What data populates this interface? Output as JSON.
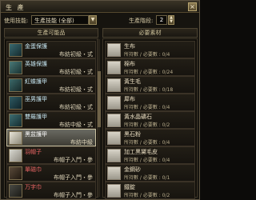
{
  "window": {
    "title": "生 產"
  },
  "filter": {
    "category_label": "使用技能:",
    "category_value": "生產技能 (全部)",
    "grade_label": "生產階段:",
    "grade_value": "2"
  },
  "left_panel": {
    "header": "生產可能品",
    "items": [
      {
        "name": "金蛋保護",
        "sub": "布紡初級・式",
        "color": "#c8e8f4"
      },
      {
        "name": "英雄保護",
        "sub": "布紡初級・式",
        "color": "#c8e8f4"
      },
      {
        "name": "紅蝶護甲",
        "sub": "布紡初級・式",
        "color": "#c8e8f4"
      },
      {
        "name": "巫男護甲",
        "sub": "布紡初級・式",
        "color": "#c8e8f4"
      },
      {
        "name": "雙羅護甲",
        "sub": "布紡中級・式",
        "color": "#c8e8f4"
      },
      {
        "name": "黑盆護甲",
        "sub": "布紡中級",
        "color": "#ffffff"
      },
      {
        "name": "羽帽子",
        "sub": "布帽子入門・參",
        "color": "#e86464"
      },
      {
        "name": "單磁巾",
        "sub": "布帽子入門・參",
        "color": "#e86464"
      },
      {
        "name": "万字巾",
        "sub": "布帽子入門・參",
        "color": "#e86464"
      }
    ]
  },
  "right_panel": {
    "header": "必要素材",
    "materials": [
      {
        "name": "生布",
        "req": "所持數 / 必要數 : 0/4"
      },
      {
        "name": "棉布",
        "req": "所持數 / 必要數 : 0/24"
      },
      {
        "name": "黃生毛",
        "req": "所持數 / 必要數 : 0/18"
      },
      {
        "name": "犀布",
        "req": "所持數 / 必要數 : 0/4"
      },
      {
        "name": "黃水晶礦石",
        "req": "所持數 / 必要數 : 0/2"
      },
      {
        "name": "黑石粉",
        "req": "所持數 / 必要數 : 0/4"
      },
      {
        "name": "加工黑黛毛皮",
        "req": "所持數 / 必要數 : 0/4"
      },
      {
        "name": "金鋼砂",
        "req": "所持數 / 必要數 : 0/1"
      },
      {
        "name": "鐵錠",
        "req": "所持數 / 必要數 : 0/2"
      }
    ]
  }
}
